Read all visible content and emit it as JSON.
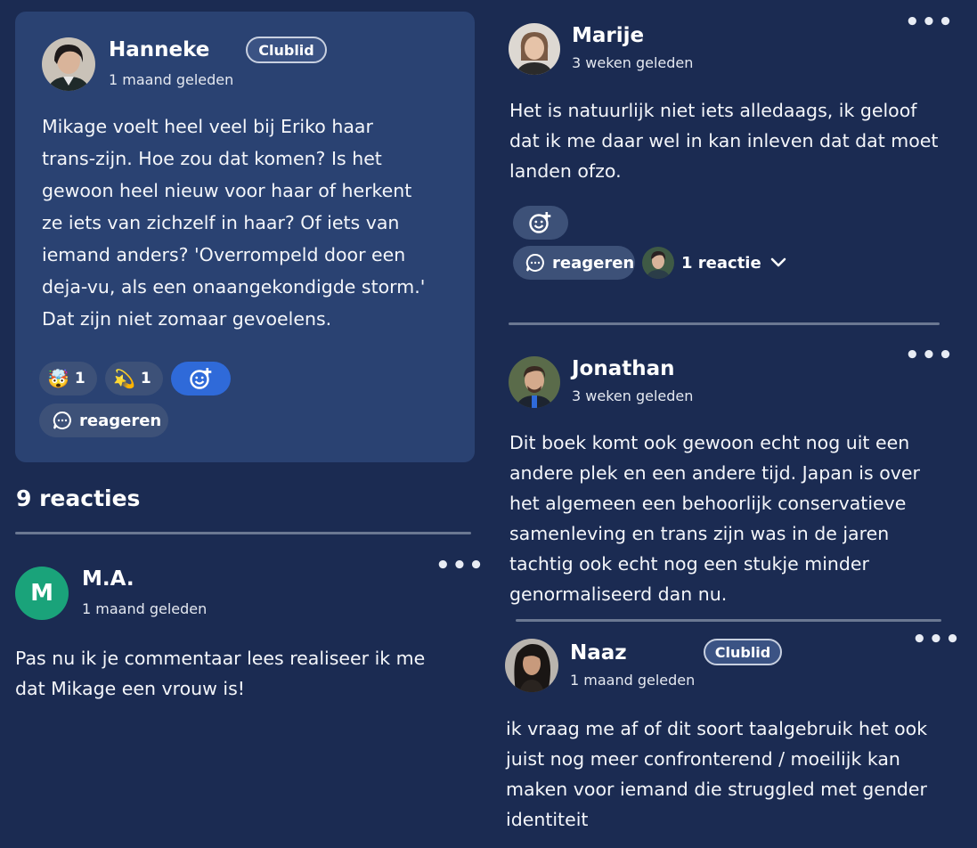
{
  "post": {
    "author": "Hanneke",
    "badge": "Clublid",
    "time": "1 maand geleden",
    "text": "Mikage voelt heel veel bij Eriko haar\ntrans-zijn. Hoe zou dat komen? Is het\ngewoon heel nieuw voor haar of herkent\nze iets van zichzelf in haar? Of iets van\niemand anders? 'Overrompeld door een\ndeja-vu, als een onaangekondigde storm.'\nDat zijn niet zomaar gevoelens.",
    "reactions": [
      {
        "emoji": "🤯",
        "icon": "mind-blown-emoji",
        "count": "1"
      },
      {
        "emoji": "💫",
        "icon": "dizzy-emoji",
        "count": "1"
      }
    ],
    "reply_label": "reageren"
  },
  "comments_heading": "9 reacties",
  "comments_left": [
    {
      "author": "M.A.",
      "avatar_letter": "M",
      "avatar_color": "#1aa37a",
      "time": "1 maand geleden",
      "text": "Pas nu ik je commentaar lees realiseer ik me\ndat Mikage een vrouw is!"
    }
  ],
  "comments_right": [
    {
      "author": "Marije",
      "time": "3 weken geleden",
      "text": "Het is natuurlijk niet iets alledaags, ik geloof\ndat ik me daar wel in kan inleven dat dat moet\nlanden ofzo.",
      "reply_label": "reageren",
      "replies_label": "1 reactie"
    },
    {
      "author": "Jonathan",
      "time": "3 weken geleden",
      "text": "Dit boek komt ook gewoon echt nog uit een\nandere plek en een andere tijd. Japan is over\nhet algemeen een behoorlijk conservatieve\nsamenleving en trans zijn was in de jaren\ntachtig ook echt nog een stukje minder\ngenormaliseerd dan nu."
    },
    {
      "author": "Naaz",
      "badge": "Clublid",
      "time": "1 maand geleden",
      "text": "ik vraag me af of dit soort taalgebruik het ook\njuist nog meer confronterend / moeilijk kan\nmaken voor iemand die struggled met gender\nidentiteit"
    }
  ],
  "more_symbol": "•••",
  "colors": {
    "background": "#1b2b52",
    "card": "#2a4272",
    "pill": "#3d5178",
    "accent_blue": "#2f6ad9",
    "avatar_green": "#1aa37a"
  }
}
